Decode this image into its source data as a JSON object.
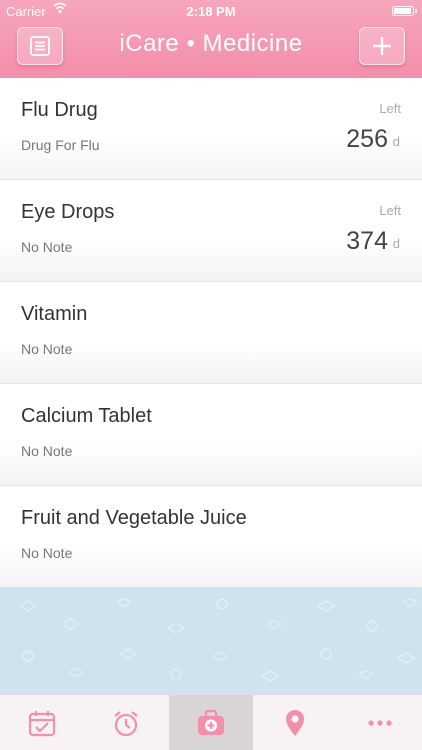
{
  "status_bar": {
    "carrier": "Carrier",
    "time": "2:18 PM",
    "battery_level": 1.0
  },
  "nav": {
    "title": "iCare • Medicine",
    "left_icon": "list-icon",
    "right_icon": "plus-icon"
  },
  "medicines": [
    {
      "name": "Flu Drug",
      "note": "Drug For Flu",
      "left_label": "Left",
      "count": "256",
      "unit": "d"
    },
    {
      "name": "Eye Drops",
      "note": "No Note",
      "left_label": "Left",
      "count": "374",
      "unit": "d"
    },
    {
      "name": "Vitamin",
      "note": "No Note"
    },
    {
      "name": "Calcium Tablet",
      "note": "No Note"
    },
    {
      "name": "Fruit and Vegetable Juice",
      "note": "No Note"
    }
  ],
  "tabs": [
    {
      "icon": "calendar-icon",
      "active": false
    },
    {
      "icon": "alarm-clock-icon",
      "active": false
    },
    {
      "icon": "medical-kit-icon",
      "active": true
    },
    {
      "icon": "location-pin-icon",
      "active": false
    },
    {
      "icon": "more-icon",
      "active": false
    }
  ],
  "colors": {
    "accent": "#f38eab",
    "background": "#cfe3ee"
  }
}
